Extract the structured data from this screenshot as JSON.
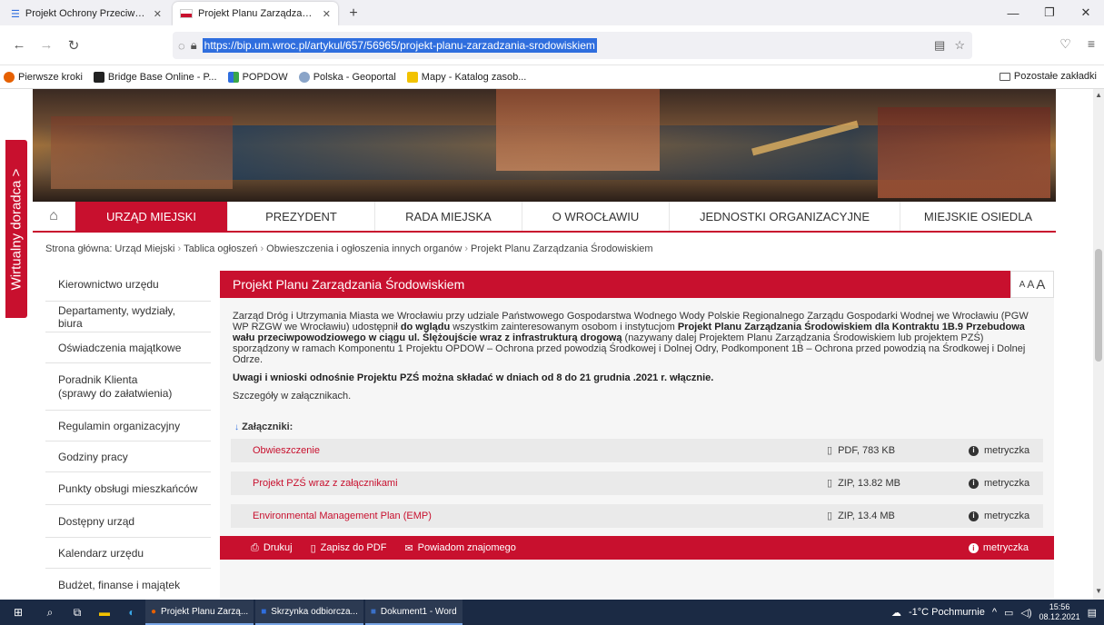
{
  "browser": {
    "tabs": [
      {
        "title": "Projekt Ochrony Przeciwpowodz",
        "active": false
      },
      {
        "title": "Projekt Planu Zarządzania Środ",
        "active": true
      }
    ],
    "url": "https://bip.um.wroc.pl/artykul/657/56965/projekt-planu-zarzadzania-srodowiskiem",
    "bookmarks": [
      "Pierwsze kroki",
      "Bridge Base Online - P...",
      "POPDOW",
      "Polska - Geoportal",
      "Mapy - Katalog zasob..."
    ],
    "other_bookmarks": "Pozostałe zakładki"
  },
  "side_tab": {
    "label": "Wirtualny doradca",
    "arrow": ">"
  },
  "main_nav": {
    "items": [
      "URZĄD MIEJSKI",
      "PREZYDENT",
      "RADA MIEJSKA",
      "O WROCŁAWIU",
      "JEDNOSTKI ORGANIZACYJNE",
      "MIEJSKIE OSIEDLA"
    ]
  },
  "breadcrumb": {
    "items": [
      "Strona główna: Urząd Miejski",
      "Tablica ogłoszeń",
      "Obwieszczenia i ogłoszenia innych organów",
      "Projekt Planu Zarządzania Środowiskiem"
    ]
  },
  "sidebar": {
    "items": [
      "Kierownictwo urzędu",
      "Departamenty, wydziały, biura",
      "Oświadczenia majątkowe",
      "Poradnik Klienta",
      "(sprawy do załatwienia)",
      "Regulamin organizacyjny",
      "Godziny pracy",
      "Punkty obsługi mieszkańców",
      "Dostępny urząd",
      "Kalendarz urzędu",
      "Budżet, finanse i majątek"
    ]
  },
  "article": {
    "title": "Projekt Planu Zarządzania Środowiskiem",
    "font_sizes": [
      "A",
      "A",
      "A"
    ],
    "p1_a": "Zarząd Dróg i Utrzymania Miasta we Wrocławiu przy udziale Państwowego Gospodarstwa Wodnego Wody Polskie Regionalnego Zarządu Gospodarki Wodnej we Wrocławiu (PGW WP RZGW we Wrocławiu) udostępnił ",
    "p1_b": "do wglądu",
    "p1_c": " wszystkim zainteresowanym osobom i instytucjom ",
    "p1_d": "Projekt Planu Zarządzania Środowiskiem dla Kontraktu 1B.9 Przebudowa wału przeciwpowodziowego w ciągu ul. Ślężoujście wraz z infrastrukturą drogową",
    "p1_e": " (nazywany dalej Projektem Planu Zarządzania Środowiskiem lub projektem PZŚ) sporządzony w ramach Komponentu 1 Projektu OPDOW – Ochrona przed powodzią Środkowej i Dolnej Odry, Podkomponent 1B – Ochrona przed powodzią na Środkowej i Dolnej Odrze.",
    "p2": "Uwagi i wnioski odnośnie Projektu PZŚ można składać w dniach od 8 do 21 grudnia .2021 r. włącznie.",
    "p3": "Szczegóły w załącznikach.",
    "attachments_label": "Załączniki:",
    "attachments": [
      {
        "name": "Obwieszczenie",
        "meta": "PDF, 783 KB",
        "metryczka": "metryczka"
      },
      {
        "name": "Projekt PZŚ wraz z załącznikami",
        "meta": "ZIP, 13.82 MB",
        "metryczka": "metryczka"
      },
      {
        "name": "Environmental Management Plan (EMP)",
        "meta": "ZIP, 13.4 MB",
        "metryczka": "metryczka"
      }
    ]
  },
  "toolbar": {
    "print": "Drukuj",
    "pdf": "Zapisz do PDF",
    "notify": "Powiadom znajomego",
    "metryczka": "metryczka"
  },
  "taskbar": {
    "apps": [
      "Projekt Planu Zarzą...",
      "Skrzynka odbiorcza...",
      "Dokument1 - Word"
    ],
    "weather": "-1°C Pochmurnie",
    "time": "15:56",
    "date": "08.12.2021"
  },
  "colors": {
    "accent": "#c8102e"
  }
}
